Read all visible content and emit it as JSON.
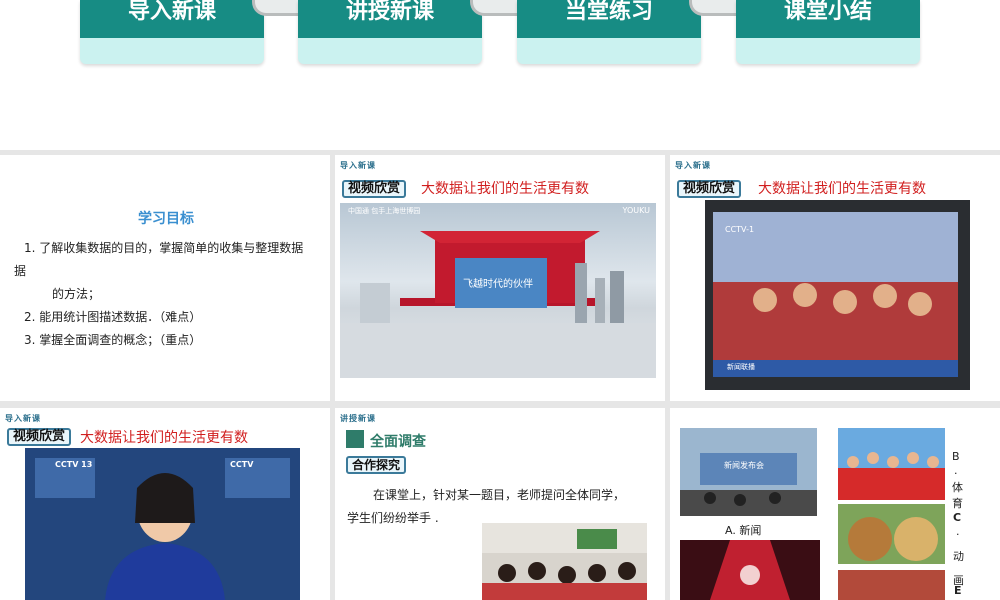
{
  "nav": [
    {
      "label": "导入新课"
    },
    {
      "label": "讲授新课"
    },
    {
      "label": "当堂练习"
    },
    {
      "label": "课堂小结"
    }
  ],
  "slide_objectives": {
    "title": "学习目标",
    "items": [
      "1. 了解收集数据的目的，掌握简单的收集与整理数据",
      "的方法；",
      "2. 能用统计图描述数据．（难点）",
      "3. 掌握全面调查的概念；（重点）"
    ],
    "wrap_prefix": "据"
  },
  "slide_video1": {
    "section_tag": "导入新课",
    "badge": "视频欣赏",
    "title": "大数据让我们的生活更有数",
    "banner_text": "飞越时代的伙伴",
    "watermark": "YOUKU",
    "logo_text": "中国通 包手上海世博园"
  },
  "slide_video2": {
    "section_tag": "导入新课",
    "badge": "视频欣赏",
    "title": "大数据让我们的生活更有数",
    "channel": "CCTV-1",
    "subtitle_text": "新闻联播"
  },
  "slide_video3": {
    "section_tag": "导入新课",
    "badge": "视频欣赏",
    "title": "大数据让我们的生活更有数",
    "channel": "CCTV 13",
    "channel2": "CCTV"
  },
  "slide_survey": {
    "section_tag": "讲授新课",
    "heading": "全面调查",
    "badge": "合作探究",
    "paragraph_line1": "在课堂上，针对某一题目，老师提问全体同学，",
    "paragraph_line2": "学生们纷纷举手 ."
  },
  "slide_options": {
    "label_a": "A. 新闻",
    "label_b": "B",
    "label_b2": ".",
    "label_b3": "体",
    "label_b4": "育",
    "label_c": "C",
    "label_c2": "·",
    "label_c3": "动",
    "label_c4": "画",
    "label_e": "E",
    "press_text": "新闻发布会"
  },
  "colors": {
    "nav_face": "#178c84",
    "nav_base": "#cbf2f0",
    "red_title": "#d11f1f",
    "objective_title": "#3a8fd0"
  }
}
